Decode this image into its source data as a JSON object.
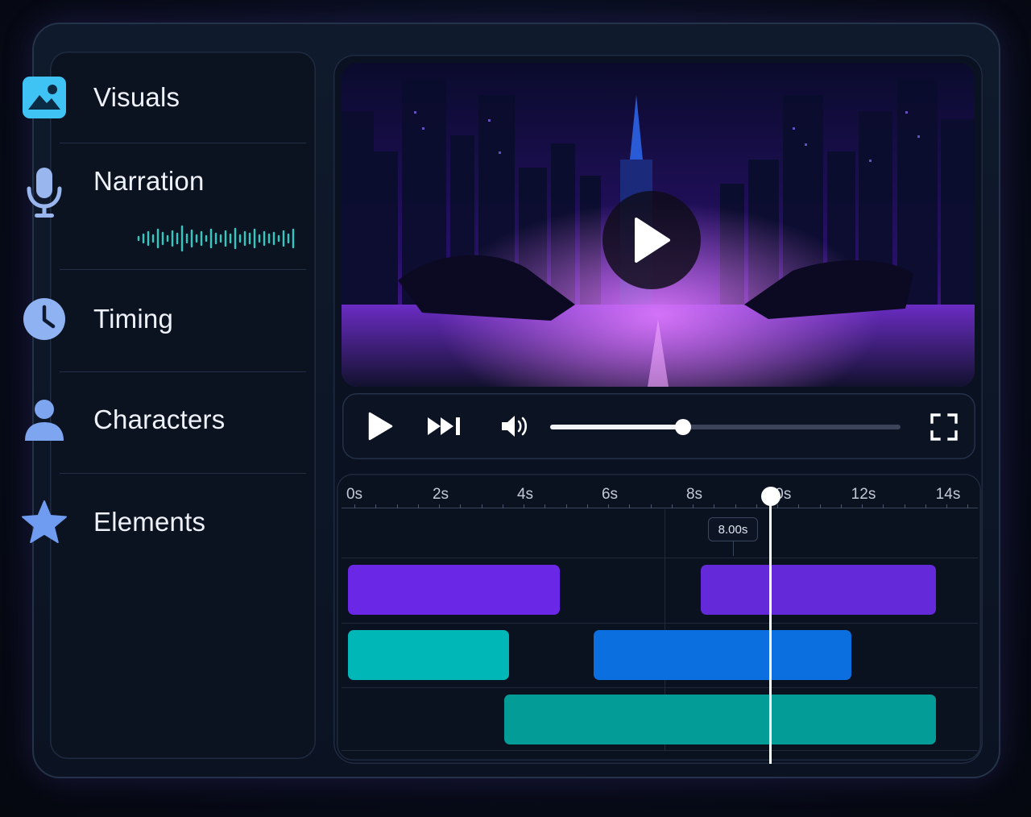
{
  "sidebar": {
    "items": [
      {
        "label": "Visuals",
        "icon": "image-icon",
        "color": "#3fc3f5"
      },
      {
        "label": "Narration",
        "icon": "microphone-icon",
        "color": "#9ab6ee"
      },
      {
        "label": "Timing",
        "icon": "clock-icon",
        "color": "#8fb2f3"
      },
      {
        "label": "Characters",
        "icon": "user-icon",
        "color": "#7ea6f0"
      },
      {
        "label": "Elements",
        "icon": "star-icon",
        "color": "#6f9cf0"
      }
    ],
    "waveform_color": "#2fc9c2"
  },
  "player": {
    "controls": [
      "play-icon",
      "skip-forward-icon",
      "volume-icon",
      "fullscreen-icon"
    ],
    "progress": 0.38
  },
  "timeline": {
    "ticks": [
      "0s",
      "2s",
      "4s",
      "6s",
      "8s",
      "10s",
      "12s",
      "14s"
    ],
    "playhead_time": "8.00s",
    "tracks": [
      {
        "clips": [
          {
            "start": 0.0,
            "end": 5.0,
            "color": "#6a28e6"
          },
          {
            "start": 8.35,
            "end": 13.9,
            "color": "#6429d8"
          }
        ]
      },
      {
        "clips": [
          {
            "start": 0.0,
            "end": 3.8,
            "color": "#00b7b8"
          },
          {
            "start": 5.8,
            "end": 11.9,
            "color": "#0c6fe0"
          }
        ]
      },
      {
        "clips": [
          {
            "start": 3.7,
            "end": 13.9,
            "color": "#049c96"
          }
        ]
      }
    ]
  }
}
